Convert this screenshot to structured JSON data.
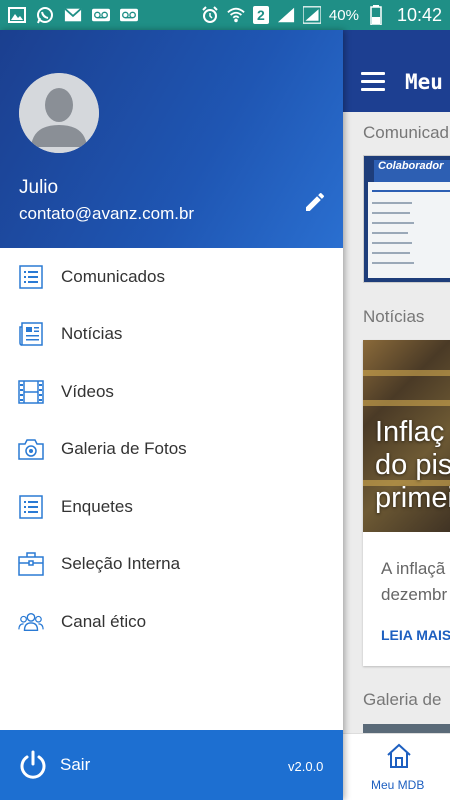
{
  "status_bar": {
    "battery": "40%",
    "time": "10:42",
    "sim_badge": "2",
    "icons": [
      "gallery-icon",
      "whatsapp-icon",
      "mail-icon",
      "voicemail-icon",
      "voicemail-icon",
      "alarm-icon",
      "wifi-icon",
      "signal-icon",
      "signal-icon",
      "battery-icon"
    ]
  },
  "drawer": {
    "user": {
      "name": "Julio",
      "email": "contato@avanz.com.br"
    },
    "menu_items": [
      {
        "label": "Comunicados",
        "icon": "list-icon"
      },
      {
        "label": "Notícias",
        "icon": "newspaper-icon"
      },
      {
        "label": "Vídeos",
        "icon": "film-icon"
      },
      {
        "label": "Galeria de Fotos",
        "icon": "camera-icon"
      },
      {
        "label": "Enquetes",
        "icon": "list-icon"
      },
      {
        "label": "Seleção Interna",
        "icon": "briefcase-icon"
      },
      {
        "label": "Canal ético",
        "icon": "people-icon"
      }
    ],
    "footer": {
      "logout_label": "Sair",
      "version": "v2.0.0"
    }
  },
  "background_app": {
    "title": "Meu",
    "sections": {
      "comunicados": "Comunicad",
      "noticias": "Notícias",
      "galeria": "Galeria de"
    },
    "comunicado_banner": "Colaborador",
    "news_headline_lines": [
      "Inflaç",
      "do pis",
      "primei"
    ],
    "news_excerpt_lines": [
      "A inflaçã",
      "dezembr"
    ],
    "read_more": "LEIA MAIS",
    "bottom_nav_label": "Meu MDB"
  },
  "colors": {
    "status_bar": "#1f8f86",
    "drawer_header": "#1f56b3",
    "footer": "#1d6fd1",
    "toolbar": "#1d3f91",
    "menu_icon": "#2a7ad4"
  }
}
